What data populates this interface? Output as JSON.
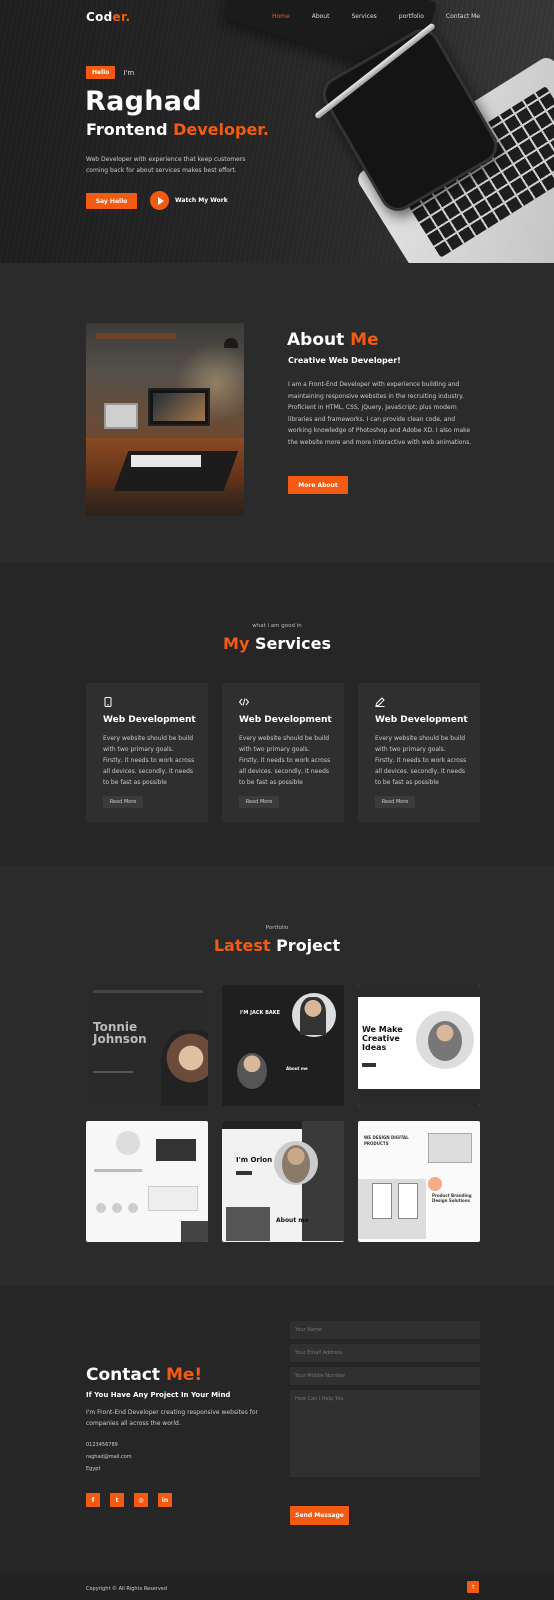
{
  "nav": {
    "logo_main": "Cod",
    "logo_accent": "er.",
    "items": [
      "Home",
      "About",
      "Services",
      "portfolio",
      "Contact Me"
    ]
  },
  "hero": {
    "badge": "Hello",
    "greeting": "I'm",
    "name": "Raghad",
    "role_main": "Frontend ",
    "role_accent": "Developer.",
    "description": "Web Developer with experience that keep customers coming back for about services makes best effort.",
    "button": "Say Hello",
    "watch_label": "Watch My Work"
  },
  "about": {
    "title_main": "About ",
    "title_accent": "Me",
    "subtitle": "Creative Web Developer!",
    "text": "I am a Front-End Developer with experience building and maintaining responsive websites in the recruiting industry. Proficient in HTML, CSS, jQuery, JavaScript; plus modern libraries and frameworks. I can provide clean code, and working knowledge of Photoshop and Adobe XD. I also make the website more and more interactive with web animations.",
    "button": "More About"
  },
  "services": {
    "pretitle": "what i am good in",
    "title_accent": "My",
    "title_main": " Services",
    "cards": [
      {
        "icon": "mobile-icon",
        "name": "Web Development",
        "desc": "Every website should be build with two primary goals. Firstly, it needs to work across all devices. secondly, it needs to be fast as possible",
        "button": "Read More"
      },
      {
        "icon": "code-icon",
        "name": "Web Development",
        "desc": "Every website should be build with two primary goals. Firstly, it needs to work across all devices. secondly, it needs to be fast as possible",
        "button": "Read More"
      },
      {
        "icon": "pen-icon",
        "name": "Web Development",
        "desc": "Every website should be build with two primary goals. Firstly, it needs to work across all devices. secondly, it needs to be fast as possible",
        "button": "Read More"
      }
    ]
  },
  "portfolio": {
    "pretitle": "Portfolio",
    "title_accent": "Latest",
    "title_main": " Project",
    "thumbs": {
      "t1": "Tonnie Johnson",
      "t2_a": "I'M JACK BAKE",
      "t2_b": "About me",
      "t3_a": "We Make",
      "t3_b": "Creative Ideas",
      "t5_a": "I'm Orlon",
      "t5_b": "About me",
      "t6_a": "WE DESIGN DIGITAL PRODUCTS",
      "t6_b": "Product Branding Design Solutions"
    }
  },
  "contact": {
    "title_main": "Contact ",
    "title_accent": "Me!",
    "subtitle": "If You Have Any Project In Your Mind",
    "text": "I'm Front-End Developer creating responsive websites for companies all across the world.",
    "phone": "0123456789",
    "email": "raghad@mail.com",
    "location": "Egypt",
    "socials": [
      "f",
      "t",
      "◎",
      "in"
    ],
    "fields": [
      "Your Name",
      "Your Email Address",
      "Your Mobile Number",
      "How Can I Help You"
    ],
    "button": "Send Message"
  },
  "footer": {
    "text": "Copyright © All Rights Reserved",
    "to_top": "↑"
  },
  "colors": {
    "accent": "#f35b13",
    "background": "#2b2b2b"
  }
}
